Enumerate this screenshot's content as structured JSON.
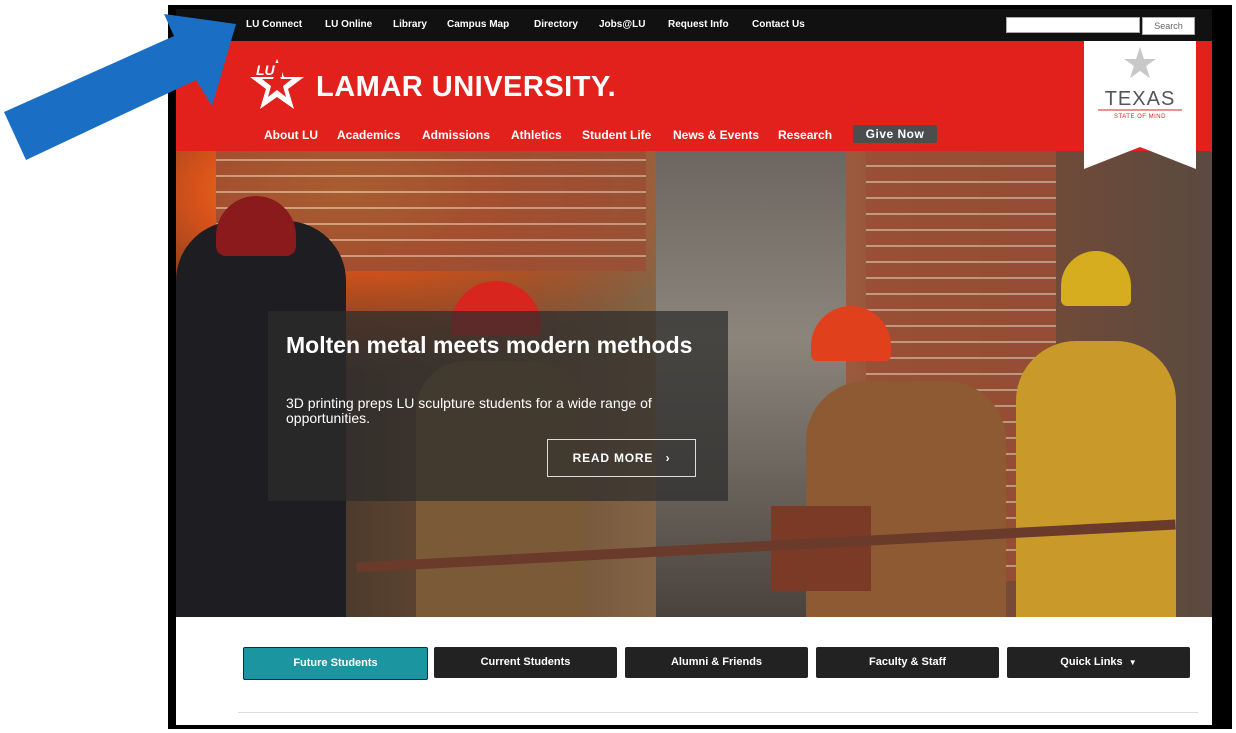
{
  "util_nav": [
    "LU Connect",
    "LU Online",
    "Library",
    "Campus Map",
    "Directory",
    "Jobs@LU",
    "Request Info",
    "Contact Us"
  ],
  "search": {
    "placeholder": "",
    "button": "Search"
  },
  "brand": {
    "logo_letters": "LU",
    "name": "LAMAR UNIVERSITY",
    "mark": "."
  },
  "main_nav": [
    "About LU",
    "Academics",
    "Admissions",
    "Athletics",
    "Student Life",
    "News & Events",
    "Research"
  ],
  "give_now": "Give Now",
  "texas_banner": {
    "word": "TEXAS",
    "tagline": "STATE OF MIND"
  },
  "hero": {
    "title": "Molten metal meets modern methods",
    "subtitle": "3D printing preps LU sculpture students for a wide range of opportunities.",
    "cta": "READ MORE",
    "cta_icon": "chevron-right-icon"
  },
  "audiences": [
    {
      "label": "Future Students",
      "active": true
    },
    {
      "label": "Current Students",
      "active": false
    },
    {
      "label": "Alumni & Friends",
      "active": false
    },
    {
      "label": "Faculty & Staff",
      "active": false
    },
    {
      "label": "Quick Links",
      "active": false,
      "icon": "caret-down-icon"
    }
  ],
  "colors": {
    "red": "#e2211c",
    "teal": "#1b95a0",
    "dark": "#111111",
    "arrow": "#1a6fc4"
  }
}
